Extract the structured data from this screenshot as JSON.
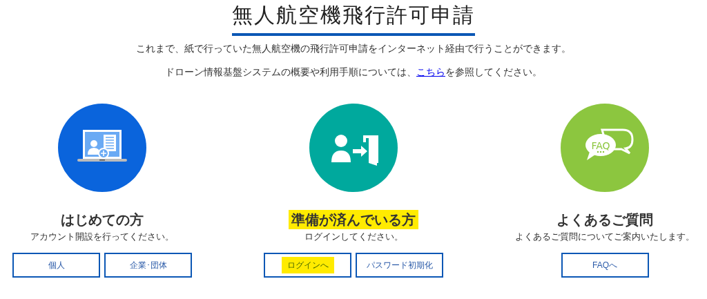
{
  "title": "無人航空機飛行許可申請",
  "intro": [
    "これまで、紙で行っていた無人航空機の飛行許可申請をインターネット経由で行うことができます。",
    {
      "before": "ドローン情報基盤システムの概要や利用手順については、",
      "link": "こちら",
      "after": "を参照してください。"
    }
  ],
  "sections": [
    {
      "kind": "laptop",
      "heading": "はじめての方",
      "highlighted": false,
      "description": "アカウント開設を行ってください。",
      "buttons": [
        {
          "label": "個人",
          "highlighted": false
        },
        {
          "label": "企業･団体",
          "highlighted": false
        }
      ]
    },
    {
      "kind": "login",
      "heading": "準備が済んでいる方",
      "highlighted": true,
      "description": "ログインしてください。",
      "buttons": [
        {
          "label": "ログインへ",
          "highlighted": true
        },
        {
          "label": "パスワード初期化",
          "highlighted": false
        }
      ]
    },
    {
      "kind": "faq",
      "icon_text": "FAQ",
      "heading": "よくあるご質問",
      "highlighted": false,
      "description": "よくあるご質問についてご案内いたします。",
      "buttons": [
        {
          "label": "FAQへ",
          "highlighted": false
        }
      ]
    }
  ]
}
